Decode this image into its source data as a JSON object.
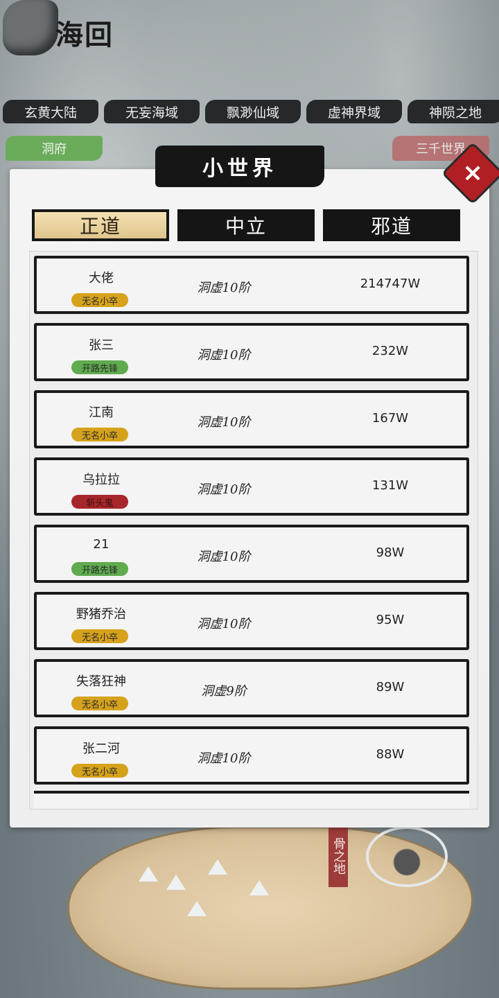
{
  "logo": {
    "text": "海回"
  },
  "region_tabs": [
    "玄黄大陆",
    "无妄海域",
    "飘渺仙域",
    "虚神界域",
    "神陨之地"
  ],
  "left_tag": "洞府",
  "right_tag": "三千世界",
  "map_banner": "骨之地",
  "panel": {
    "title": "小世界",
    "close_label": "×",
    "tabs": [
      {
        "label": "正道",
        "active": true
      },
      {
        "label": "中立",
        "active": false
      },
      {
        "label": "邪道",
        "active": false
      }
    ]
  },
  "colors": {
    "badge_gold": "#d6a21c",
    "badge_green": "#5fab4f",
    "badge_red": "#a8272b",
    "left_tag": "#6aac5a",
    "right_tag": "#b96a6a"
  },
  "rows": [
    {
      "name": "大佬",
      "badge": "无名小卒",
      "badge_color": "gold",
      "level": "洞虚10阶",
      "power": "214747W"
    },
    {
      "name": "张三",
      "badge": "开路先锋",
      "badge_color": "green",
      "level": "洞虚10阶",
      "power": "232W"
    },
    {
      "name": "江南",
      "badge": "无名小卒",
      "badge_color": "gold",
      "level": "洞虚10阶",
      "power": "167W"
    },
    {
      "name": "乌拉拉",
      "badge": "斩头鬼",
      "badge_color": "red",
      "level": "洞虚10阶",
      "power": "131W"
    },
    {
      "name": "21",
      "badge": "开路先锋",
      "badge_color": "green",
      "level": "洞虚10阶",
      "power": "98W"
    },
    {
      "name": "野猪乔治",
      "badge": "无名小卒",
      "badge_color": "gold",
      "level": "洞虚10阶",
      "power": "95W"
    },
    {
      "name": "失落狂神",
      "badge": "无名小卒",
      "badge_color": "gold",
      "level": "洞虚9阶",
      "power": "89W"
    },
    {
      "name": "张二河",
      "badge": "无名小卒",
      "badge_color": "gold",
      "level": "洞虚10阶",
      "power": "88W"
    }
  ]
}
